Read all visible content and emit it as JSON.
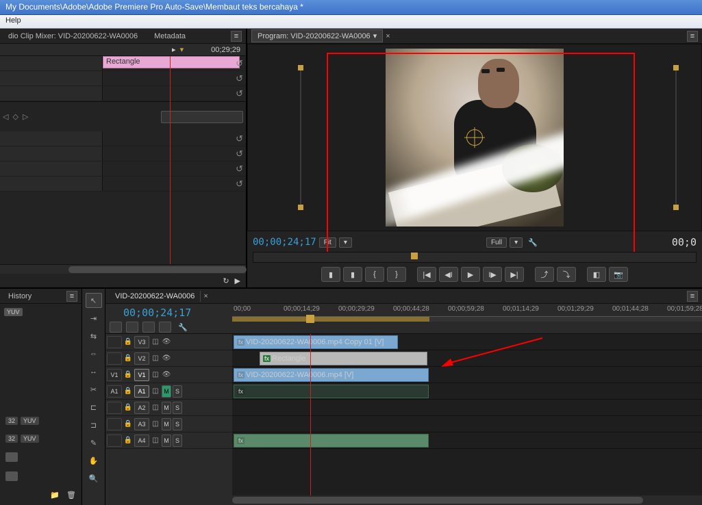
{
  "titlebar": "My Documents\\Adobe\\Adobe Premiere Pro Auto-Save\\Membaut teks bercahaya *",
  "menubar": {
    "help": "Help"
  },
  "effects_panel": {
    "tab_mixer": "dio Clip Mixer: VID-20200622-WA0006",
    "tab_meta": "Metadata",
    "ruler_time": "00;29;29",
    "playhead_icon": "▶",
    "clip_label": "Rectangle"
  },
  "program_panel": {
    "tab_label": "Program: VID-20200622-WA0006",
    "current_tc": "00;00;24;17",
    "fit_label": "Fit",
    "quality_label": "Full",
    "duration_tc": "00;0"
  },
  "transport": {
    "mark_in": "▮",
    "mark_out": "▮",
    "in": "{",
    "out": "}",
    "goto_in": "|◀",
    "step_back": "◀I",
    "play": "▶",
    "step_fwd": "I▶",
    "goto_out": "▶|",
    "lift": "⤴",
    "extract": "⤵",
    "export": "◧",
    "snapshot": "📷"
  },
  "history_panel": {
    "tab": "History"
  },
  "badges": {
    "b1": "32",
    "b2": "YUV",
    "b3": "32",
    "b4": "YUV"
  },
  "timeline": {
    "tab": "VID-20200622-WA0006",
    "tc": "00;00;24;17",
    "ruler": [
      "00;00",
      "00;00;14;29",
      "00;00;29;29",
      "00;00;44;28",
      "00;00;59;28",
      "00;01;14;29",
      "00;01;29;29",
      "00;01;44;28",
      "00;01;59;28"
    ],
    "tracks": {
      "v3": "V3",
      "v2": "V2",
      "v1_outer": "V1",
      "v1": "V1",
      "a1_outer": "A1",
      "a1": "A1",
      "a2": "A2",
      "a3": "A3",
      "a4": "A4",
      "m": "M",
      "s": "S"
    },
    "clips": {
      "v3": "VID-20200622-WA0006.mp4 Copy 01 [V]",
      "v2": "Rectangle",
      "v1": "VID-20200622-WA0006.mp4 [V]",
      "fx": "fx"
    }
  }
}
